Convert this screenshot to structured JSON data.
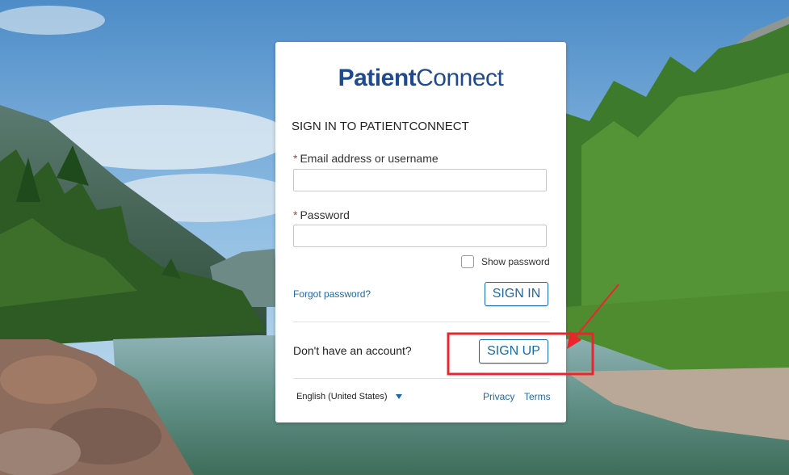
{
  "brand": {
    "logo_part1": "Patient",
    "logo_part2": "Connect",
    "color": "#1f4a8f"
  },
  "form": {
    "heading": "SIGN IN TO PATIENTCONNECT",
    "required_marker": "*",
    "email_label": "Email address or username",
    "email_value": "",
    "password_label": "Password",
    "password_value": "",
    "show_password_label": "Show password",
    "forgot_password": "Forgot password?",
    "sign_in": "SIGN IN"
  },
  "signup": {
    "prompt": "Don't have an account?",
    "button": "SIGN UP"
  },
  "footer": {
    "language": "English (United States)",
    "privacy": "Privacy",
    "terms": "Terms"
  },
  "colors": {
    "accent": "#1b6aa8",
    "required": "#c23934",
    "annotation": "#e8262b"
  },
  "icons": {
    "language_dropdown": "caret-down-icon",
    "annotation": "red-arrow-icon"
  }
}
